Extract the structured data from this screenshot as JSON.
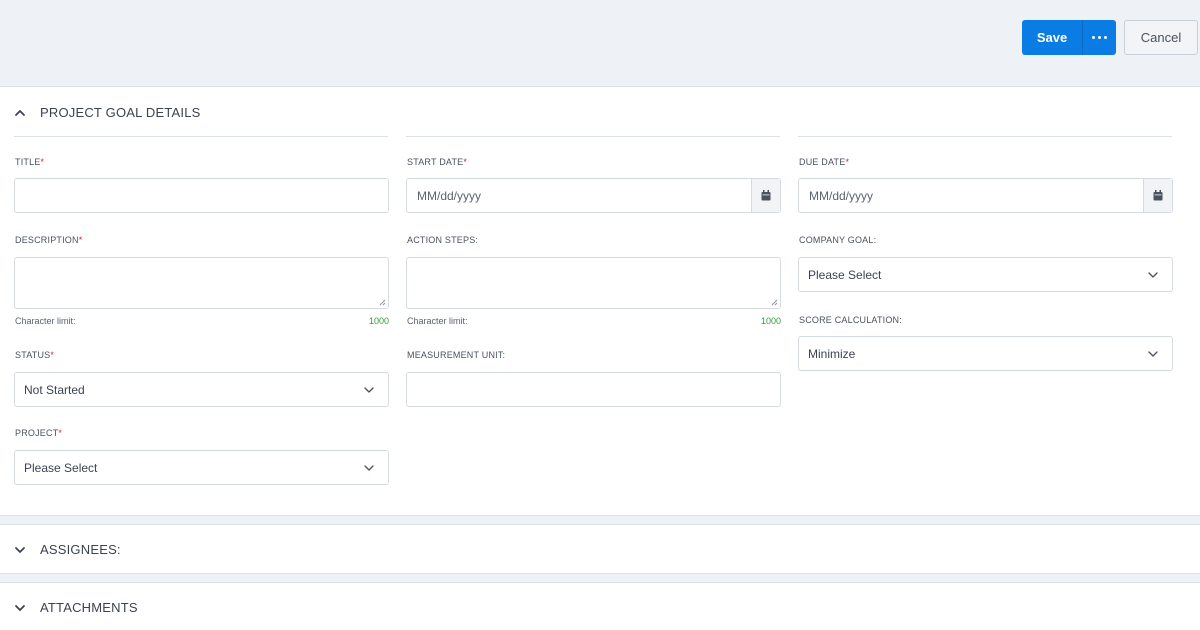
{
  "toolbar": {
    "save_label": "Save",
    "more_icon": "ellipsis-icon",
    "cancel_label": "Cancel",
    "accent_color": "#0b7ce3"
  },
  "sections": {
    "details_title": "PROJECT GOAL DETAILS",
    "assignees_title": "ASSIGNEES:",
    "attachments_title": "ATTACHMENTS"
  },
  "fields": {
    "title": {
      "label": "TITLE",
      "required_mark": "*",
      "value": ""
    },
    "start_date": {
      "label": "START DATE",
      "required_mark": "*",
      "placeholder": "MM/dd/yyyy"
    },
    "due_date": {
      "label": "DUE DATE",
      "required_mark": "*",
      "placeholder": "MM/dd/yyyy"
    },
    "description": {
      "label": "DESCRIPTION",
      "required_mark": "*",
      "char_limit_label": "Character limit:",
      "char_limit": "1000"
    },
    "action_steps": {
      "label": "ACTION STEPS:",
      "char_limit_label": "Character limit:",
      "char_limit": "1000"
    },
    "company_goal": {
      "label": "COMPANY GOAL:",
      "selected": "Please Select"
    },
    "score_calculation": {
      "label": "SCORE CALCULATION:",
      "selected": "Minimize"
    },
    "status": {
      "label": "STATUS",
      "required_mark": "*",
      "selected": "Not Started"
    },
    "measurement_unit": {
      "label": "MEASUREMENT UNIT:",
      "value": ""
    },
    "project": {
      "label": "PROJECT",
      "required_mark": "*",
      "selected": "Please Select"
    }
  }
}
